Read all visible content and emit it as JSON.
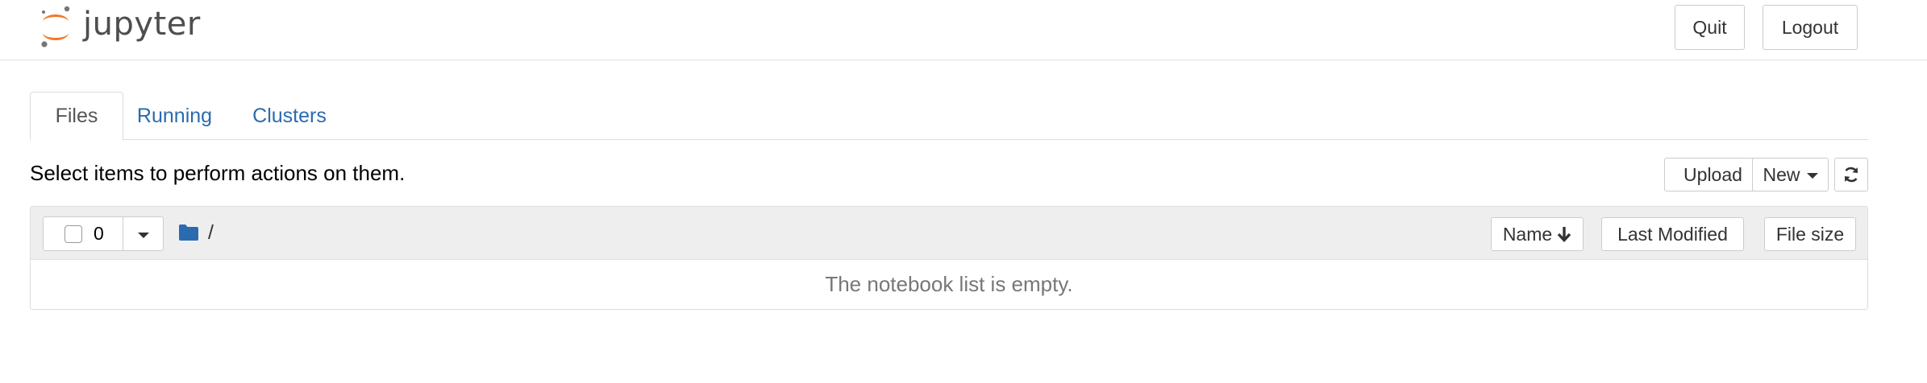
{
  "header": {
    "logo_text": "jupyter",
    "quit_label": "Quit",
    "logout_label": "Logout",
    "logo_colors": {
      "arc": "#f37726",
      "dot": "#767677"
    }
  },
  "tabs": [
    {
      "label": "Files",
      "active": true
    },
    {
      "label": "Running",
      "active": false
    },
    {
      "label": "Clusters",
      "active": false
    }
  ],
  "toolbar": {
    "instructions": "Select items to perform actions on them.",
    "upload_label": "Upload",
    "new_label": "New",
    "refresh_icon": "refresh-icon"
  },
  "list": {
    "selected_count": "0",
    "breadcrumb": "/",
    "columns": {
      "name": "Name",
      "last_modified": "Last Modified",
      "file_size": "File size"
    },
    "sort": {
      "column": "name",
      "direction": "descending",
      "icon": "arrow-down-icon"
    },
    "empty_message": "The notebook list is empty."
  },
  "colors": {
    "link": "#2a6bb0",
    "folder": "#2a6bb0",
    "list_header_bg": "#eeeeee",
    "empty_text": "#777777"
  }
}
